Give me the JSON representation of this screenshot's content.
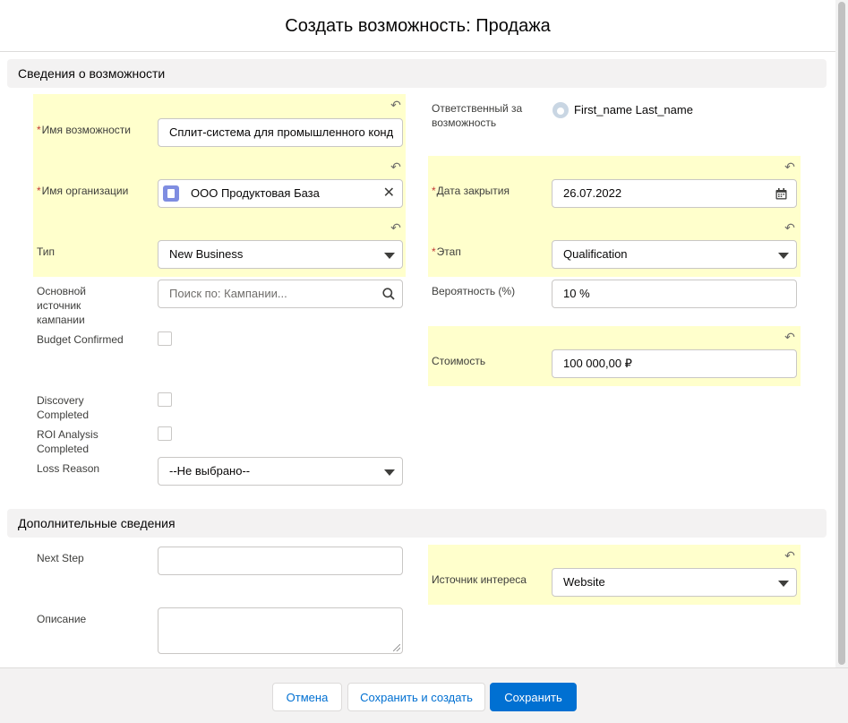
{
  "modal": {
    "title": "Создать возможность: Продажа"
  },
  "sections": {
    "info": "Сведения о возможности",
    "additional": "Дополнительные сведения"
  },
  "fields": {
    "opportunity_name": {
      "label": "Имя возможности",
      "value": "Сплит-система для промышленного конд"
    },
    "account_name": {
      "label": "Имя организации",
      "value": "ООО Продуктовая База"
    },
    "type": {
      "label": "Тип",
      "value": "New Business"
    },
    "campaign_source": {
      "label": "Основной источник кампании",
      "placeholder": "Поиск по: Кампании..."
    },
    "budget_confirmed": {
      "label": "Budget Confirmed",
      "checked": false
    },
    "discovery_completed": {
      "label": "Discovery Completed",
      "checked": false
    },
    "roi_completed": {
      "label": "ROI Analysis Completed",
      "checked": false
    },
    "loss_reason": {
      "label": "Loss Reason",
      "value": "--Не выбрано--"
    },
    "owner": {
      "label": "Ответственный за возможность",
      "value": "First_name Last_name"
    },
    "close_date": {
      "label": "Дата закрытия",
      "value": "26.07.2022"
    },
    "stage": {
      "label": "Этап",
      "value": "Qualification"
    },
    "probability": {
      "label": "Вероятность (%)",
      "value": "10 %"
    },
    "amount": {
      "label": "Стоимость",
      "value": "100 000,00 ₽"
    },
    "next_step": {
      "label": "Next Step",
      "value": ""
    },
    "lead_source": {
      "label": "Источник интереса",
      "value": "Website"
    },
    "description": {
      "label": "Описание",
      "value": ""
    }
  },
  "footer": {
    "cancel": "Отмена",
    "save_new": "Сохранить и создать",
    "save": "Сохранить"
  },
  "icons": {
    "undo": "undo-icon",
    "search": "search-icon",
    "calendar": "calendar-icon",
    "clear": "clear-icon",
    "dropdown": "chevron-down-icon",
    "owner": "user-avatar-icon",
    "account": "account-icon"
  },
  "colors": {
    "highlight": "#ffffcc",
    "brand": "#0070d2",
    "required": "#c23934"
  }
}
